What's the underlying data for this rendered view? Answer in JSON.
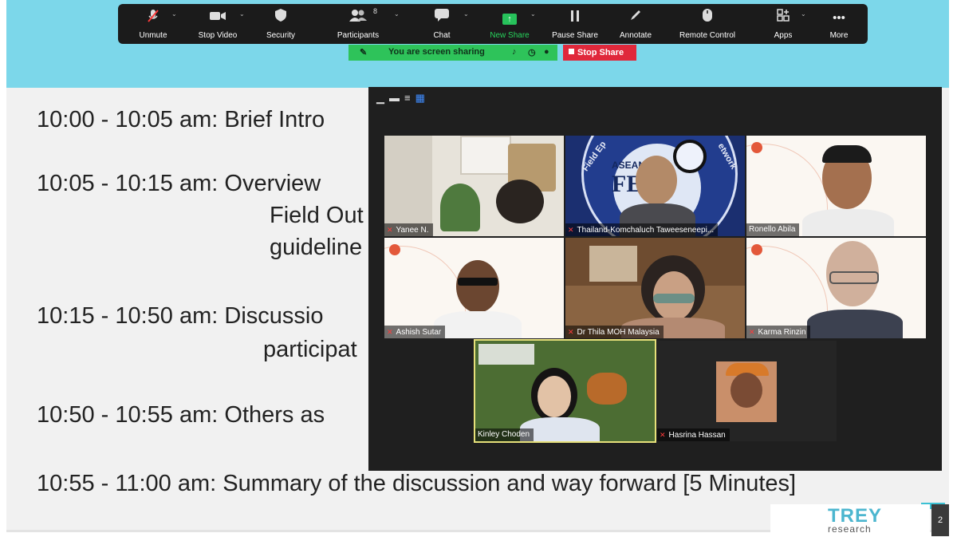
{
  "toolbar": {
    "unmute": "Unmute",
    "stop_video": "Stop Video",
    "security": "Security",
    "participants": "Participants",
    "participants_count": "8",
    "chat": "Chat",
    "new_share": "New Share",
    "pause_share": "Pause Share",
    "annotate": "Annotate",
    "remote_control": "Remote Control",
    "apps": "Apps",
    "more": "More"
  },
  "share_status": {
    "message": "You are screen sharing",
    "stop_label": "Stop Share"
  },
  "agenda": [
    {
      "time": "10:00 - 10:05 am:",
      "text": "Brief Intro"
    },
    {
      "time": "10:05 - 10:15 am:",
      "text": "Overview",
      "extra": [
        "Field Out",
        "guideline"
      ]
    },
    {
      "time": "10:15 - 10:50 am:",
      "text": "Discussio",
      "extra": [
        "participat"
      ]
    },
    {
      "time": "10:50 - 10:55 am:",
      "text": "Others as"
    },
    {
      "time": "10:55 - 11:00 am:",
      "text": "Summary of the discussion and way forward [5 Minutes]"
    }
  ],
  "participants": [
    {
      "name": "Yanee N.",
      "muted": true
    },
    {
      "name": "Thailand-Komchaluch Taweeseneepi...",
      "muted": true
    },
    {
      "name": "Ronello Abila",
      "muted": false
    },
    {
      "name": "Ashish Sutar",
      "muted": true
    },
    {
      "name": "Dr Thila MOH Malaysia",
      "muted": true
    },
    {
      "name": "Karma  Rinzin",
      "muted": true
    },
    {
      "name": "Kinley Choden",
      "muted": false
    },
    {
      "name": "Hasrina Hassan",
      "muted": true
    }
  ],
  "tile_text": {
    "asean_logo": "ASEAN",
    "asean_letters": "FEN",
    "arc_left": "Field Ep",
    "arc_right": "etwork"
  },
  "branding": {
    "logo_title": "TREY",
    "logo_subtitle": "research",
    "page_number": "2"
  },
  "colors": {
    "slide_header": "#7cd7ea",
    "share_green": "#2ec35a",
    "stop_red": "#e0283b",
    "logo_blue": "#4cb6cf"
  }
}
